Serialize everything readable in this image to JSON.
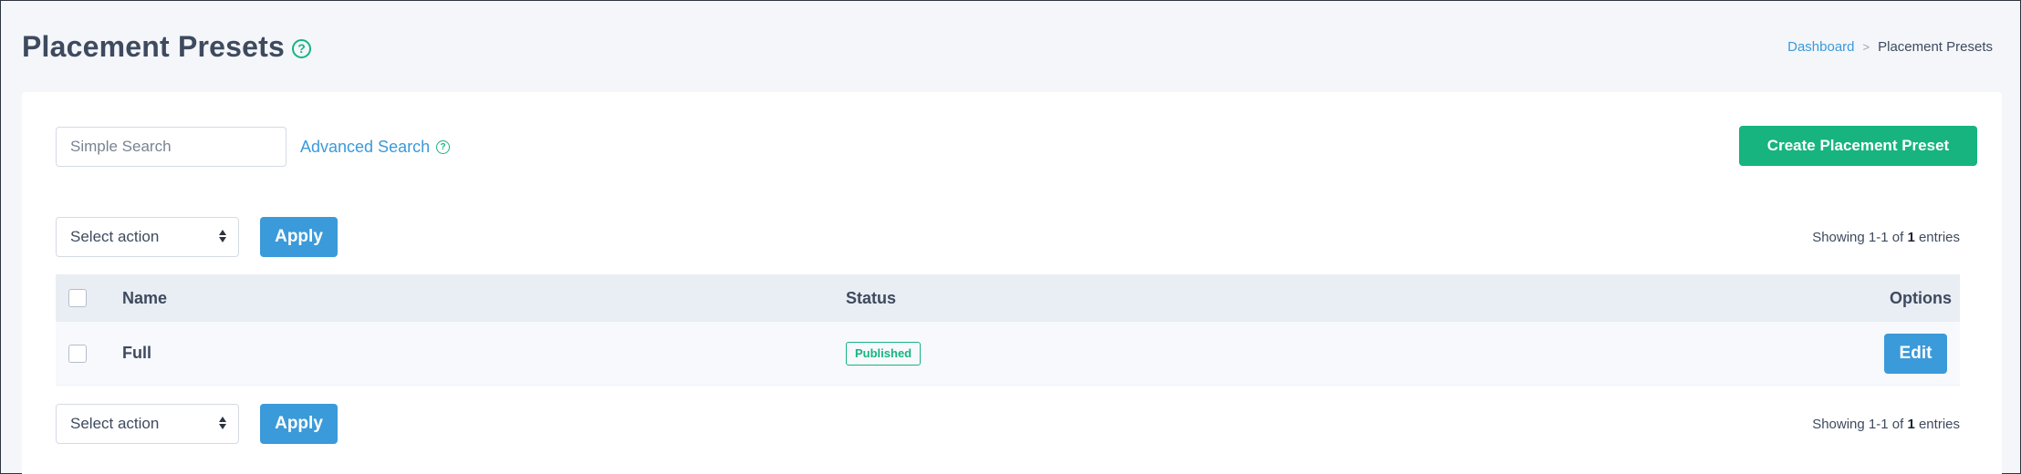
{
  "header": {
    "title": "Placement Presets",
    "help_icon": "?",
    "breadcrumb": {
      "link": "Dashboard",
      "separator": ">",
      "current": "Placement Presets"
    }
  },
  "toolbar": {
    "search_placeholder": "Simple Search",
    "advanced_search_label": "Advanced Search",
    "help_icon": "?",
    "create_label": "Create Placement Preset"
  },
  "bulk": {
    "select_value": "Select action",
    "apply_label": "Apply",
    "showing_prefix": "Showing 1-1 of",
    "showing_total": "1",
    "showing_suffix": "entries"
  },
  "table": {
    "columns": {
      "name": "Name",
      "status": "Status",
      "options": "Options"
    },
    "rows": [
      {
        "name": "Full",
        "status": "Published",
        "action": "Edit"
      }
    ]
  },
  "colors": {
    "primary": "#3b9ad9",
    "success": "#17b47f",
    "background": "#f4f6fa",
    "text": "#3e4a5e"
  }
}
